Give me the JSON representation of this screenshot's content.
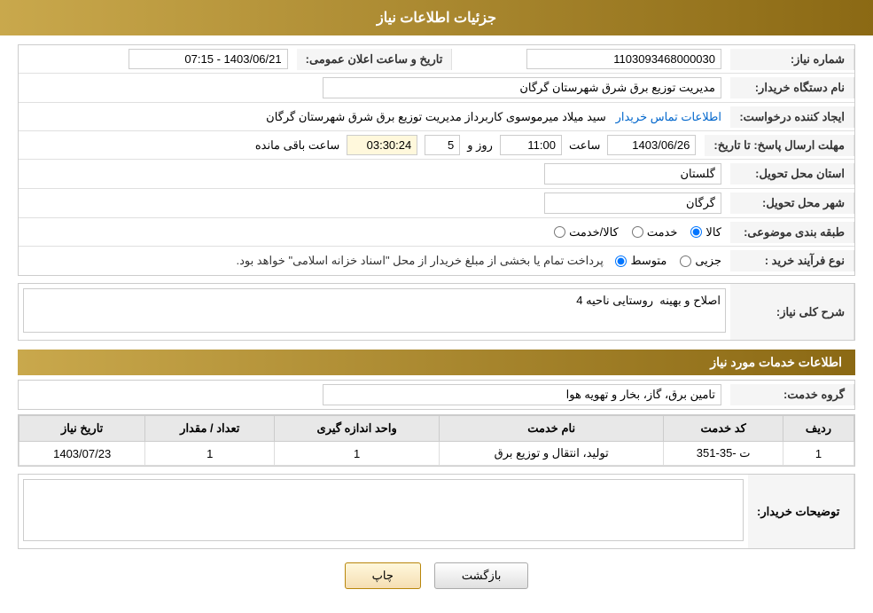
{
  "page": {
    "title": "جزئیات اطلاعات نیاز"
  },
  "header": {
    "section1_title": "اطلاعات خدمات مورد نیاز",
    "section2_title": "جزئیات اطلاعات نیاز"
  },
  "fields": {
    "shomara_niaz_label": "شماره نیاز:",
    "shomara_niaz_value": "1103093468000030",
    "tarikh_label": "تاریخ و ساعت اعلان عمومی:",
    "tarikh_value": "1403/06/21 - 07:15",
    "nam_dastgah_label": "نام دستگاه خریدار:",
    "nam_dastgah_value": "مدیریت توزیع برق شرق شهرستان گرگان",
    "ijad_konande_label": "ایجاد کننده درخواست:",
    "ijad_konande_value": "سید میلاد میرموسوی کاربرداز مدیریت توزیع برق شرق شهرستان گرگان",
    "ijad_konande_link": "اطلاعات تماس خریدار",
    "mohlat_label": "مهلت ارسال پاسخ: تا تاریخ:",
    "mohlat_date": "1403/06/26",
    "mohlat_saat_label": "ساعت",
    "mohlat_saat": "11:00",
    "mohlat_roz_label": "روز و",
    "mohlat_roz": "5",
    "mohlat_baqi_label": "ساعت باقی مانده",
    "mohlat_baqi": "03:30:24",
    "ostan_label": "استان محل تحویل:",
    "ostan_value": "گلستان",
    "shahr_label": "شهر محل تحویل:",
    "shahr_value": "گرگان",
    "tabaqe_label": "طبقه بندی موضوعی:",
    "tabaqe_options": [
      "کالا",
      "خدمت",
      "کالا/خدمت"
    ],
    "tabaqe_selected": "کالا",
    "navoe_farayand_label": "نوع فرآیند خرید :",
    "navoe_options": [
      "جزیی",
      "متوسط"
    ],
    "navoe_note": "پرداخت تمام یا بخشی از مبلغ خریدار از محل \"اسناد خزانه اسلامی\" خواهد بود.",
    "sharh_niaz_label": "شرح کلی نیاز:",
    "sharh_niaz_value": "اصلاح و بهینه  روستایی ناحیه 4",
    "grooh_khedmat_label": "گروه خدمت:",
    "grooh_khedmat_value": "تامین برق، گاز، بخار و تهویه هوا"
  },
  "table": {
    "headers": [
      "ردیف",
      "کد خدمت",
      "نام خدمت",
      "واحد اندازه گیری",
      "تعداد / مقدار",
      "تاریخ نیاز"
    ],
    "rows": [
      {
        "radif": "1",
        "kod": "ت -35-351",
        "nam": "تولید، انتقال و توزیع برق",
        "vahed": "1",
        "tedad": "1",
        "tarikh": "1403/07/23"
      }
    ]
  },
  "description_section": {
    "label": "توضیحات خریدار:",
    "value": ""
  },
  "buttons": {
    "print": "چاپ",
    "back": "بازگشت"
  }
}
